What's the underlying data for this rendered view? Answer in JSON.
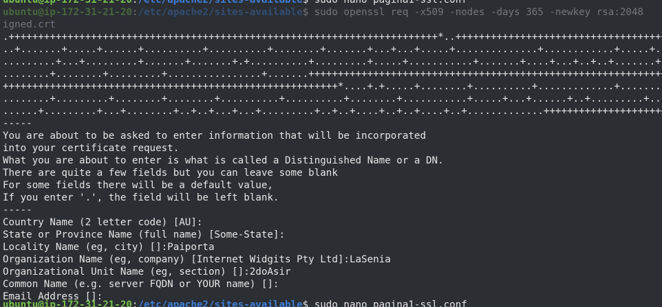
{
  "prompt": {
    "user_host": "ubuntu@ip-172-31-21-20",
    "sep": ":",
    "path": "/etc/apache2/sites-available",
    "sym": "$"
  },
  "commands": {
    "top_cut": " sudo nano pagina1-ssl.conf",
    "prev": " sudo openssl req -x509 -nodes -days 365 -newkey rsa:2048",
    "prev_wrap": "igned.crt",
    "next": " sudo nano pagina1-ssl.conf"
  },
  "key_gen": [
    ".+++++++++++++++++++++++++++++++++++++++++++++++++++++++++++++++++++++++++*..+++++++++++++++++++++++++++++++++++++++++++++",
    "..+.......+.....+......+..........+..........+........+.......+...+...+.....+..............+............+.....+......+",
    ".........+...+.........+.......+.......+.+..........+.........+.....+...........+.......+....+...+..+..+.......+.......",
    "........+........+.........+................+.......++++++++++++++++++++++++++++++++++++++++++++++++++++++++++++++++++",
    "+++++++++++++++++++++++++++++++++++++++++++++++++++++++++*....+.+.....+........+..........+.............+.........+....",
    "........+.........+........+........+..........+..........+........+...........+.....+...+......+..+.........+.......+.",
    "......+.........+...+........+..+..+...+...+.........+..+..+....+..+..+....+..+.............++++++++++++++++++++++++++"
  ],
  "intro": [
    "-----",
    "You are about to be asked to enter information that will be incorporated",
    "into your certificate request.",
    "What you are about to enter is what is called a Distinguished Name or a DN.",
    "There are quite a few fields but you can leave some blank",
    "For some fields there will be a default value,",
    "If you enter '.', the field will be left blank.",
    "-----"
  ],
  "fields": [
    {
      "label": "Country Name (2 letter code) [AU]:",
      "value": ""
    },
    {
      "label": "State or Province Name (full name) [Some-State]:",
      "value": ""
    },
    {
      "label": "Locality Name (eg, city) []:",
      "value": "Paiporta"
    },
    {
      "label": "Organization Name (eg, company) [Internet Widgits Pty Ltd]:",
      "value": "LaSenia"
    },
    {
      "label": "Organizational Unit Name (eg, section) []:",
      "value": "2doAsir"
    },
    {
      "label": "Common Name (e.g. server FQDN or YOUR name) []:",
      "value": ""
    },
    {
      "label": "Email Address []:",
      "value": ""
    }
  ]
}
